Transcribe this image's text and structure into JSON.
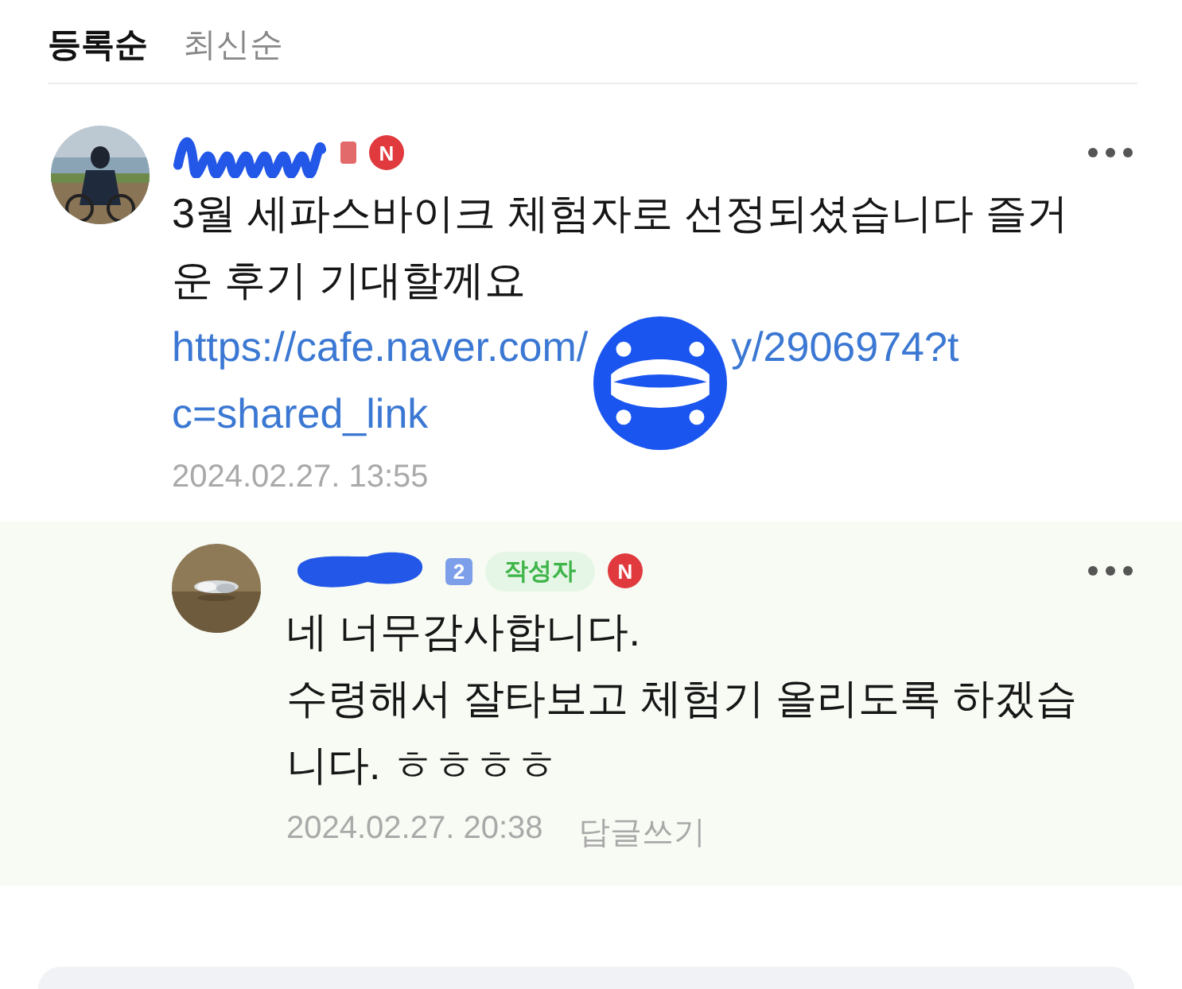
{
  "sort_tabs": [
    {
      "label": "등록순",
      "selected": true
    },
    {
      "label": "최신순",
      "selected": false
    }
  ],
  "comments": [
    {
      "kind": "comment",
      "is_writer": false,
      "new_mark": "N",
      "body": "3월 세파스바이크 체험자로 선정되셨습니다 즐거운 후기 기대할께요",
      "link_parts": [
        "https://cafe.naver.com/",
        "y/2906974?t",
        "c=shared_link"
      ],
      "date": "2024.02.27. 13:55"
    },
    {
      "kind": "reply",
      "level_badge": "2",
      "is_writer": true,
      "writer_label": "작성자",
      "new_mark": "N",
      "body": "네 너무감사합니다.\n수령해서 잘타보고 체험기 올리도록 하겠습니다. ㅎㅎㅎㅎ",
      "date": "2024.02.27. 20:38",
      "reply_action": "답글쓰기"
    }
  ]
}
